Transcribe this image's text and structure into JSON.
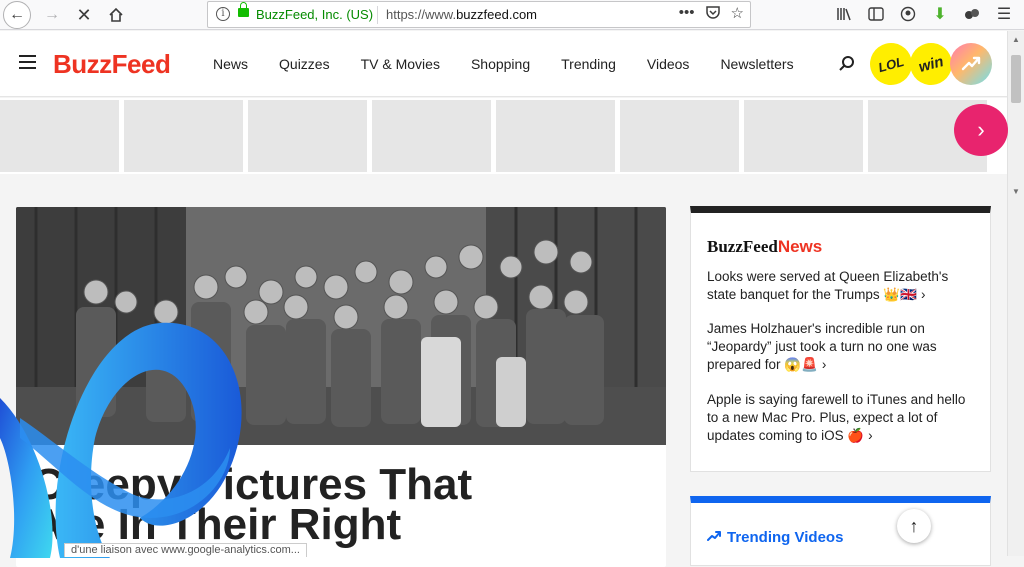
{
  "browser": {
    "identity": "BuzzFeed, Inc. (US)",
    "url_scheme": "https://www.",
    "url_domain": "buzzfeed.com"
  },
  "site": {
    "logo": "BuzzFeed",
    "nav": [
      "News",
      "Quizzes",
      "TV & Movies",
      "Shopping",
      "Trending",
      "Videos",
      "Newsletters"
    ],
    "badges": {
      "lol": "LOL",
      "win": "win"
    }
  },
  "story": {
    "headline_line1": "Creepy Pictures That",
    "headline_line2": "Are In Their Right"
  },
  "news_card": {
    "logo_main": "BuzzFeed",
    "logo_suffix": "News",
    "items": [
      {
        "text": "Looks were served at Queen Elizabeth's state banquet for the Trumps 👑🇬🇧"
      },
      {
        "text": "James Holzhauer's incredible run on “Jeopardy” just took a turn no one was prepared for 😱🚨"
      },
      {
        "text": "Apple is saying farewell to iTunes and hello to a new Mac Pro. Plus, expect a lot of updates coming to iOS 🍎"
      }
    ]
  },
  "trending_card": {
    "title": "Trending Videos"
  },
  "status_text": "d'une liaison avec www.google-analytics.com..."
}
